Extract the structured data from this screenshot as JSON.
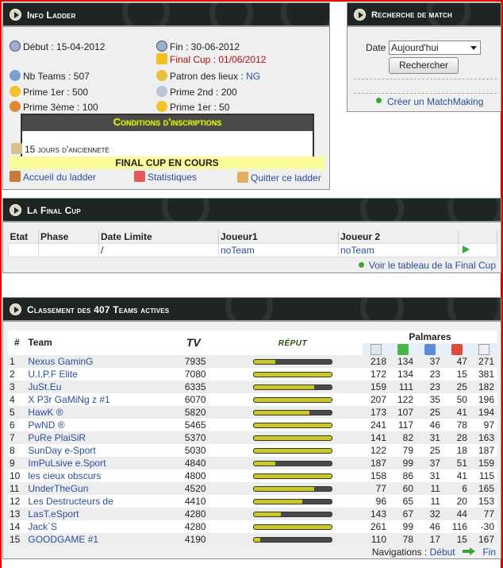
{
  "info": {
    "title": "Info Ladder",
    "debut": "Début : 15-04-2012",
    "fin": "Fin : 30-06-2012",
    "final_cup": "Final Cup : 01/06/2012",
    "nb_teams": "Nb Teams : 507",
    "patron_label": "Patron des lieux :",
    "patron_value": "NG",
    "prime1": "Prime 1er : 500",
    "prime2": "Prime 2nd : 200",
    "prime3": "Prime 3ème : 100",
    "prime1b": "Prime 1er : 50",
    "conditions_title": "Conditions d'inscriptions",
    "condition_1": "15 jours d'ancienneté",
    "banner": "FINAL CUP EN COURS",
    "link_home": "Accueil du ladder",
    "link_stats": "Statistiques",
    "link_quit": "Quitter ce ladder"
  },
  "search": {
    "title": "Recherche de match",
    "date_label": "Date",
    "date_value": "Aujourd'hui",
    "button": "Rechercher",
    "link": "Créer un MatchMaking"
  },
  "finalcup": {
    "title": "La Final Cup",
    "headers": [
      "Etat",
      "Phase",
      "Date Limite",
      "Joueur1",
      "Joueur 2"
    ],
    "row": {
      "etat": "",
      "phase": "",
      "date": "/",
      "j1": "noTeam",
      "j2": "noTeam"
    },
    "link": "Voir le tableau de la Final Cup"
  },
  "ranking": {
    "title": "Classement des 407 Teams actives",
    "h_num": "#",
    "h_team": "Team",
    "h_tv": "TV",
    "h_reput": "RÉPUT",
    "h_palmares": "Palmares",
    "rows": [
      {
        "n": "1",
        "team": "Nexus GaminG",
        "tv": "7935",
        "rep": 0.28,
        "a": "218",
        "b": "134",
        "c": "37",
        "d": "47",
        "e": "271"
      },
      {
        "n": "2",
        "team": "U.I.P.F Elite",
        "tv": "7080",
        "rep": 1.0,
        "a": "172",
        "b": "134",
        "c": "23",
        "d": "15",
        "e": "381"
      },
      {
        "n": "3",
        "team": "JuSt.Eu",
        "tv": "6335",
        "rep": 0.78,
        "a": "159",
        "b": "111",
        "c": "23",
        "d": "25",
        "e": "182"
      },
      {
        "n": "4",
        "team": "X P3r GaMiNg z #1",
        "tv": "6070",
        "rep": 1.0,
        "a": "207",
        "b": "122",
        "c": "35",
        "d": "50",
        "e": "196"
      },
      {
        "n": "5",
        "team": "HawK ®",
        "tv": "5820",
        "rep": 0.72,
        "a": "173",
        "b": "107",
        "c": "25",
        "d": "41",
        "e": "194"
      },
      {
        "n": "6",
        "team": "PwND ®",
        "tv": "5465",
        "rep": 1.0,
        "a": "241",
        "b": "117",
        "c": "46",
        "d": "78",
        "e": "97"
      },
      {
        "n": "7",
        "team": "PuRe PlaiSiR",
        "tv": "5370",
        "rep": 1.0,
        "a": "141",
        "b": "82",
        "c": "31",
        "d": "28",
        "e": "163"
      },
      {
        "n": "8",
        "team": "SunDay e-Sport",
        "tv": "5030",
        "rep": 1.0,
        "a": "122",
        "b": "79",
        "c": "25",
        "d": "18",
        "e": "187"
      },
      {
        "n": "9",
        "team": "ImPuLsive e.Sport",
        "tv": "4840",
        "rep": 0.28,
        "a": "187",
        "b": "99",
        "c": "37",
        "d": "51",
        "e": "159"
      },
      {
        "n": "10",
        "team": "les cieux obscurs",
        "tv": "4800",
        "rep": 1.0,
        "a": "158",
        "b": "86",
        "c": "31",
        "d": "41",
        "e": "115"
      },
      {
        "n": "11",
        "team": "UnderTheGun",
        "tv": "4520",
        "rep": 0.78,
        "a": "77",
        "b": "60",
        "c": "11",
        "d": "6",
        "e": "165"
      },
      {
        "n": "12",
        "team": "Les Destructeurs de",
        "tv": "4410",
        "rep": 0.62,
        "a": "96",
        "b": "65",
        "c": "11",
        "d": "20",
        "e": "153"
      },
      {
        "n": "13",
        "team": "LasT.eSport",
        "tv": "4280",
        "rep": 0.35,
        "a": "143",
        "b": "67",
        "c": "32",
        "d": "44",
        "e": "77"
      },
      {
        "n": "14",
        "team": "Jack`S",
        "tv": "4280",
        "rep": 1.0,
        "a": "261",
        "b": "99",
        "c": "46",
        "d": "116",
        "e": "-30"
      },
      {
        "n": "15",
        "team": "GOODGAME #1",
        "tv": "4190",
        "rep": 0.08,
        "a": "110",
        "b": "78",
        "c": "17",
        "d": "15",
        "e": "167"
      }
    ],
    "nav_label": "Navigations :",
    "nav_debut": "Début",
    "nav_fin": "Fin"
  }
}
